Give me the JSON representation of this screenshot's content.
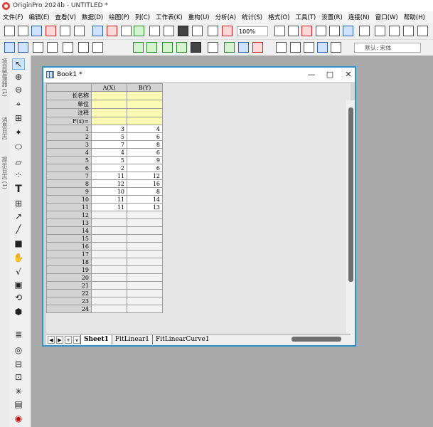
{
  "app": {
    "title": "OriginPro 2024b - UNTITLED *"
  },
  "menu": [
    "文件(F)",
    "编辑(E)",
    "查看(V)",
    "数据(D)",
    "绘图(P)",
    "列(C)",
    "工作表(K)",
    "重构(U)",
    "分析(A)",
    "统计(S)",
    "格式(O)",
    "工具(T)",
    "设置(R)",
    "连接(N)",
    "窗口(W)",
    "帮助(H)"
  ],
  "toolbar": {
    "zoom": "100%",
    "font": "默认: 宋体"
  },
  "side_panels": [
    "项目管理器 (1)",
    "消息日志",
    "提示日志 (1)"
  ],
  "book": {
    "title": "Book1 *",
    "columns": [
      "A(X)",
      "B(Y)"
    ],
    "label_rows": [
      "长名称",
      "单位",
      "注释",
      "F(x)="
    ],
    "rows": [
      [
        "1",
        "3",
        "4"
      ],
      [
        "2",
        "5",
        "6"
      ],
      [
        "3",
        "7",
        "8"
      ],
      [
        "4",
        "4",
        "6"
      ],
      [
        "5",
        "5",
        "9"
      ],
      [
        "6",
        "2",
        "6"
      ],
      [
        "7",
        "11",
        "12"
      ],
      [
        "8",
        "12",
        "16"
      ],
      [
        "9",
        "10",
        "8"
      ],
      [
        "10",
        "11",
        "14"
      ],
      [
        "11",
        "11",
        "13"
      ],
      [
        "12",
        "",
        ""
      ],
      [
        "13",
        "",
        ""
      ],
      [
        "14",
        "",
        ""
      ],
      [
        "15",
        "",
        ""
      ],
      [
        "16",
        "",
        ""
      ],
      [
        "17",
        "",
        ""
      ],
      [
        "18",
        "",
        ""
      ],
      [
        "19",
        "",
        ""
      ],
      [
        "20",
        "",
        ""
      ],
      [
        "21",
        "",
        ""
      ],
      [
        "22",
        "",
        ""
      ],
      [
        "23",
        "",
        ""
      ],
      [
        "24",
        "",
        ""
      ]
    ],
    "sheets": [
      "Sheet1",
      "FitLinear1",
      "FitLinearCurve1"
    ]
  }
}
